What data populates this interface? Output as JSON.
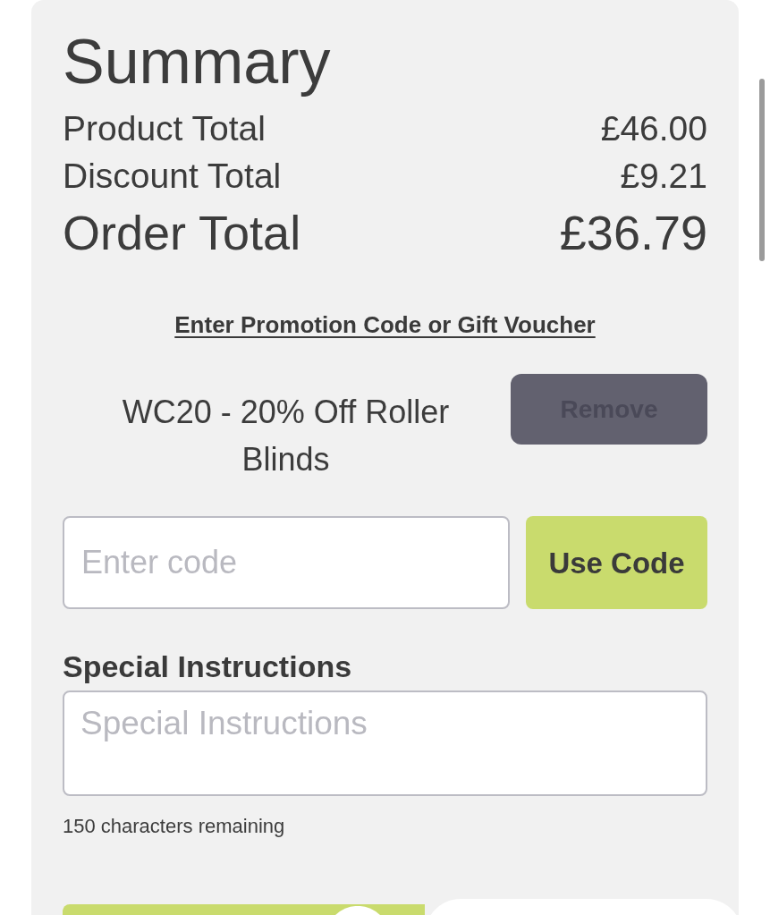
{
  "summary": {
    "title": "Summary",
    "lines": [
      {
        "kind": "subtotal",
        "label": "Product Total",
        "value": "£46.00"
      },
      {
        "kind": "subtotal",
        "label": "Discount Total",
        "value": "£9.21"
      },
      {
        "kind": "total",
        "label": "Order Total",
        "value": "£36.79"
      }
    ]
  },
  "promotion": {
    "link": "Enter Promotion Code or Gift Voucher",
    "applied": [
      {
        "description": "WC20 - 20% Off Roller Blinds",
        "button": "Remove"
      }
    ],
    "code_field": {
      "placeholder": "Enter code"
    },
    "button": "Use Code"
  },
  "special_instructions": {
    "label": "Special Instructions",
    "field": {
      "placeholder": "Special Instructions"
    },
    "counter": "150 characters remaining"
  }
}
